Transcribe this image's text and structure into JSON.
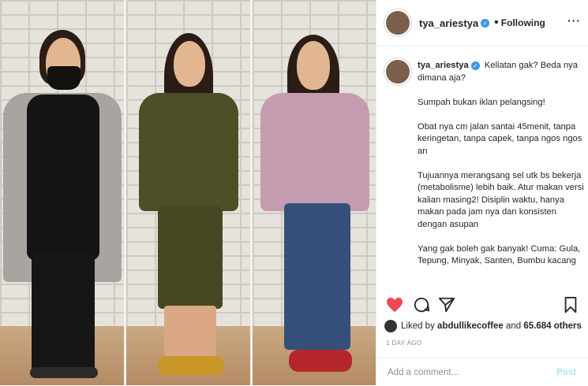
{
  "header": {
    "username": "tya_ariestya",
    "follow_label": "Following",
    "separator": "•",
    "more_icon": "more-options-icon"
  },
  "caption": {
    "username": "tya_ariestya",
    "lines": "Keliatan gak? Beda nya dimana aja?\n\nSumpah bukan iklan pelangsing!\n\nObat nya cm jalan santai 45menit, tanpa keringetan, tanpa capek, tanpa ngos ngos an\n\nTujuannya merangsang sel utk bs bekerja (metabolisme) lebih baik. Atur makan versi kalian masing2! Disiplin waktu, hanya makan pada jam nya dan konsisten dengan asupan\n\nYang gak boleh gak banyak! Cuma: Gula, Tepung, Minyak, Santen, Bumbu kacang"
  },
  "actions": {
    "like_icon": "heart-icon",
    "comment_icon": "comment-icon",
    "share_icon": "share-icon",
    "save_icon": "bookmark-icon",
    "like_color": "#ed4956"
  },
  "likes": {
    "prefix": "Liked by",
    "liker": "abdullikecoffee",
    "and": "and",
    "others": "65.684 others"
  },
  "timestamp": "1 DAY AGO",
  "comment_box": {
    "placeholder": "Add a comment...",
    "post_label": "Post"
  }
}
